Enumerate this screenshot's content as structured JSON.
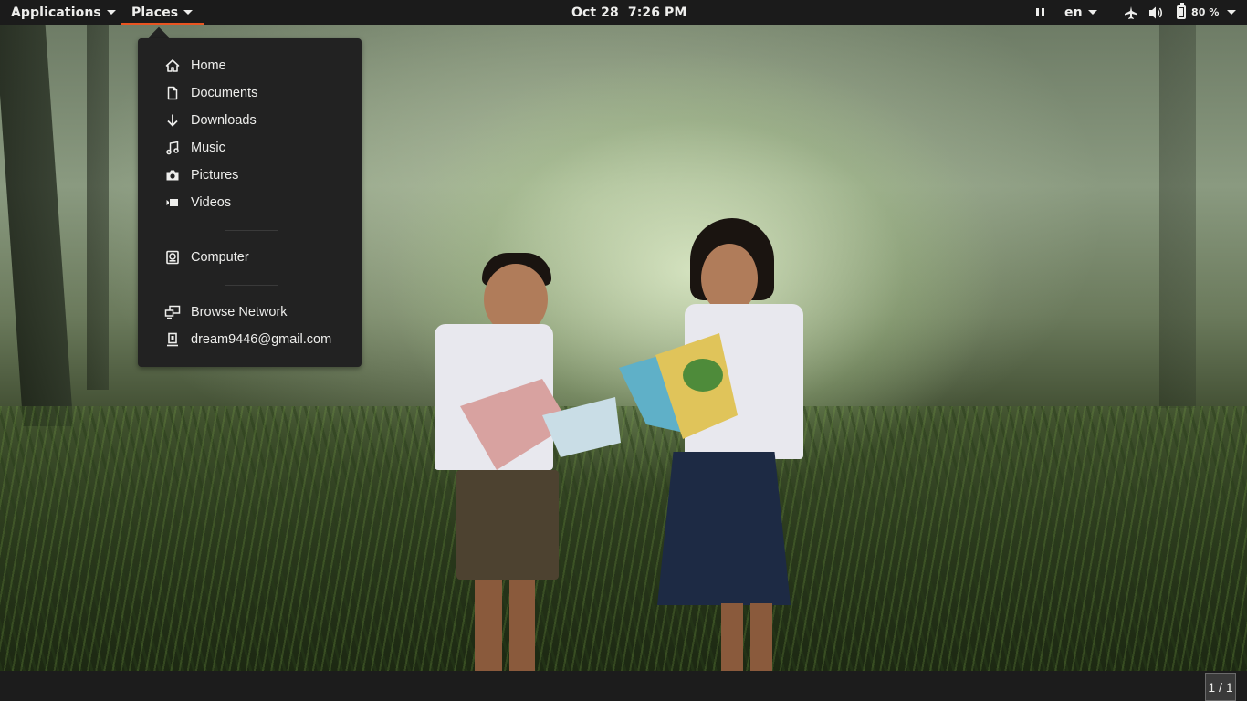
{
  "topbar": {
    "applications_label": "Applications",
    "places_label": "Places",
    "date": "Oct 28",
    "time": "7:26 PM",
    "language": "en",
    "battery_percent": "80 %",
    "battery_level": 0.8,
    "icons": {
      "pause": "media-pause-icon",
      "airplane": "airplane-mode-icon",
      "volume": "volume-icon",
      "battery": "battery-icon",
      "system_menu": "chevron-down-icon"
    }
  },
  "places_menu": {
    "items": [
      {
        "label": "Home",
        "icon": "home-icon"
      },
      {
        "label": "Documents",
        "icon": "document-icon"
      },
      {
        "label": "Downloads",
        "icon": "download-icon"
      },
      {
        "label": "Music",
        "icon": "music-icon"
      },
      {
        "label": "Pictures",
        "icon": "camera-icon"
      },
      {
        "label": "Videos",
        "icon": "video-icon"
      }
    ],
    "computer_label": "Computer",
    "browse_network_label": "Browse Network",
    "account_label": "dream9446@gmail.com"
  },
  "bottombar": {
    "workspace_indicator": "1 / 1"
  },
  "colors": {
    "panel_bg": "#1b1b1b",
    "menu_bg": "#222222",
    "accent": "#e95420",
    "text": "#eeeeec"
  }
}
